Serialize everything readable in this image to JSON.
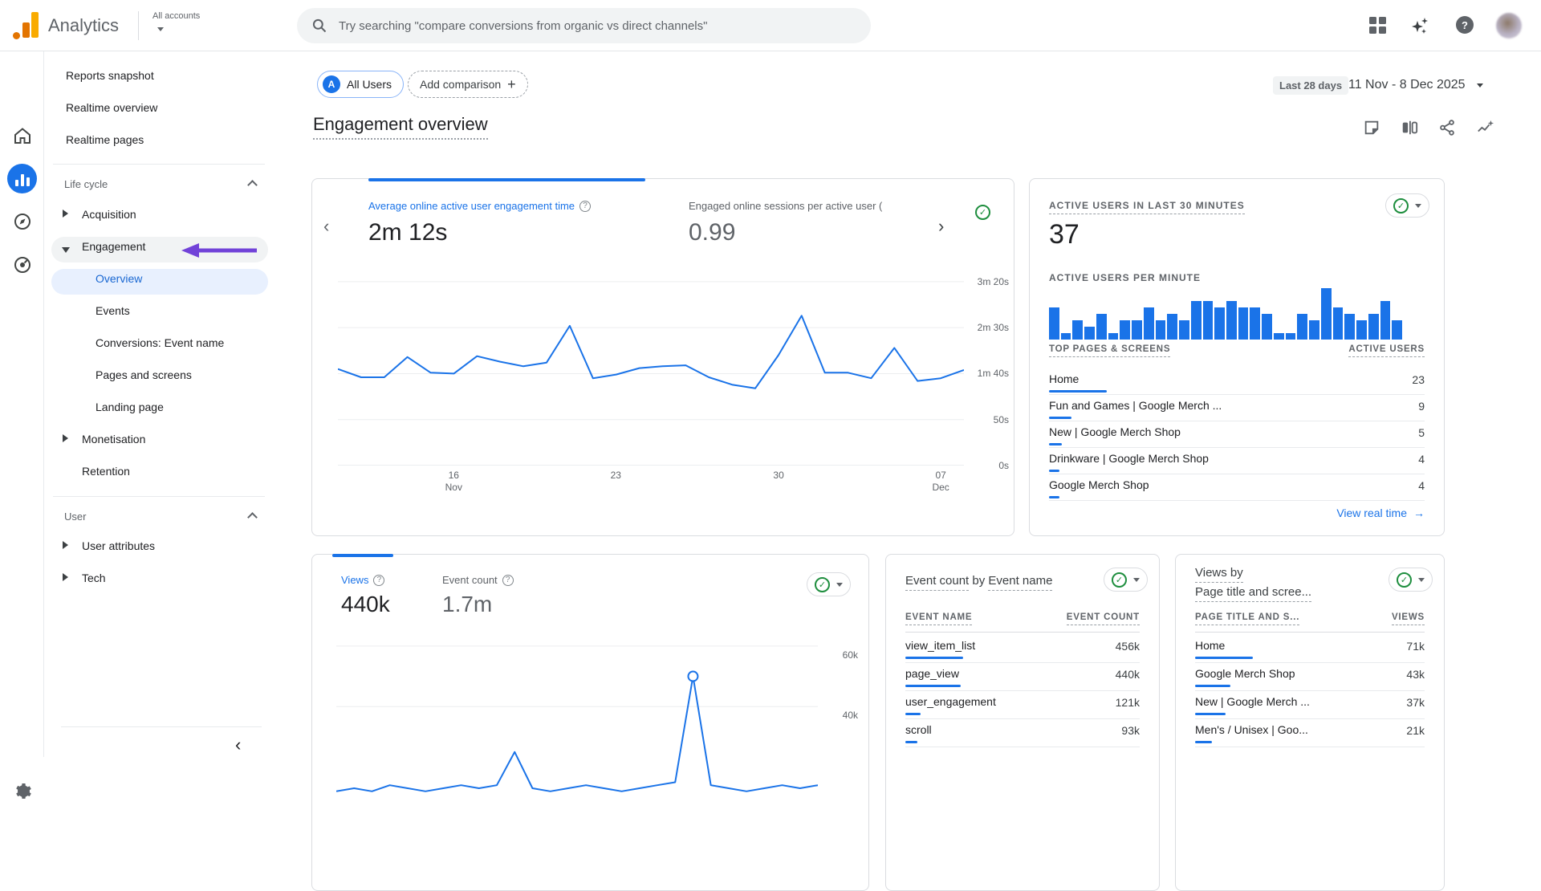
{
  "colors": {
    "accent": "#1a73e8",
    "green_check": "#1e8e3e",
    "annotation_purple": "#7142d8",
    "bar_blue": "#1a73e8"
  },
  "icons": {
    "topbar": [
      "apps-grid-icon",
      "ai-sparkle-icon",
      "help-icon",
      "avatar"
    ],
    "rail": [
      "home-icon",
      "reports-icon",
      "explore-icon",
      "advertising-icon",
      "settings-gear-icon"
    ],
    "report_actions": [
      "note-icon",
      "ab-compare-icon",
      "share-icon",
      "insights-icon"
    ]
  },
  "topbar": {
    "product": "Analytics",
    "account": "All accounts",
    "search_placeholder": "Try searching \"compare conversions from organic vs direct channels\""
  },
  "sidebar": {
    "top_items": [
      "Reports snapshot",
      "Realtime overview",
      "Realtime pages"
    ],
    "lifecycle_header": "Life cycle",
    "acquisition": "Acquisition",
    "engagement": "Engagement",
    "engagement_children": [
      "Overview",
      "Events",
      "Conversions: Event name",
      "Pages and screens",
      "Landing page"
    ],
    "selected_child": "Overview",
    "monetisation": "Monetisation",
    "retention": "Retention",
    "user_header": "User",
    "user_items": [
      "User attributes",
      "Tech"
    ]
  },
  "controls": {
    "all_users_badge": "A",
    "all_users": "All Users",
    "add_comparison": "Add comparison",
    "date_preset": "Last 28 days",
    "date_range": "11 Nov - 8 Dec 2025"
  },
  "page": {
    "title": "Engagement overview"
  },
  "cards": {
    "engagement": {
      "metric1_label": "Average online active user engagement time",
      "metric1_value": "2m 12s",
      "metric2_label": "Engaged online sessions per active user (",
      "metric2_value": "0.99"
    },
    "realtime": {
      "title": "ACTIVE USERS IN LAST 30 MINUTES",
      "value": "37",
      "per_minute_label": "ACTIVE USERS PER MINUTE",
      "col1": "TOP PAGES & SCREENS",
      "col2": "ACTIVE USERS",
      "rows": [
        {
          "label": "Home",
          "value": "23",
          "num": 23
        },
        {
          "label": "Fun and Games | Google Merch ...",
          "value": "9",
          "num": 9
        },
        {
          "label": "New | Google Merch Shop",
          "value": "5",
          "num": 5
        },
        {
          "label": "Drinkware | Google Merch Shop",
          "value": "4",
          "num": 4
        },
        {
          "label": "Google Merch Shop",
          "value": "4",
          "num": 4
        }
      ],
      "link": "View real time"
    },
    "views": {
      "metric1_label": "Views",
      "metric1_value": "440k",
      "metric2_label": "Event count",
      "metric2_value": "1.7m"
    },
    "events": {
      "title_part1": "Event count",
      "title_joiner": "by",
      "title_part2": "Event name",
      "col1": "EVENT NAME",
      "col2": "EVENT COUNT",
      "rows": [
        {
          "label": "view_item_list",
          "value": "456k",
          "num": 456
        },
        {
          "label": "page_view",
          "value": "440k",
          "num": 440
        },
        {
          "label": "user_engagement",
          "value": "121k",
          "num": 121
        },
        {
          "label": "scroll",
          "value": "93k",
          "num": 93
        }
      ]
    },
    "pages": {
      "title_line1": "Views by",
      "title_line2": "Page title and scree...",
      "col1": "PAGE TITLE AND S...",
      "col2": "VIEWS",
      "rows": [
        {
          "label": "Home",
          "value": "71k",
          "num": 71
        },
        {
          "label": "Google Merch Shop",
          "value": "43k",
          "num": 43
        },
        {
          "label": "New | Google Merch ...",
          "value": "37k",
          "num": 37
        },
        {
          "label": "Men's / Unisex | Goo...",
          "value": "21k",
          "num": 21
        }
      ]
    }
  },
  "chart_data": [
    {
      "id": "engagement-time-trend",
      "type": "line",
      "title": "Average online active user engagement time",
      "unit": "seconds",
      "x_start": "11 Nov 2025",
      "x_end": "8 Dec 2025",
      "values": [
        105,
        96,
        96,
        118,
        101,
        100,
        119,
        113,
        108,
        112,
        152,
        95,
        99,
        106,
        108,
        109,
        96,
        88,
        84,
        120,
        163,
        101,
        101,
        95,
        128,
        92,
        95,
        104
      ],
      "ylim": [
        0,
        213
      ],
      "grid": "on",
      "gridlines": [
        {
          "v": 200,
          "label": "3m 20s"
        },
        {
          "v": 150,
          "label": "2m 30s"
        },
        {
          "v": 100,
          "label": "1m 40s"
        },
        {
          "v": 50,
          "label": "50s"
        },
        {
          "v": 0,
          "label": "0s"
        }
      ],
      "xticks": [
        {
          "frac": 0.185,
          "line1": "16",
          "line2": "Nov"
        },
        {
          "frac": 0.444,
          "line1": "23",
          "line2": ""
        },
        {
          "frac": 0.704,
          "line1": "30",
          "line2": ""
        },
        {
          "frac": 0.963,
          "line1": "07",
          "line2": "Dec"
        }
      ]
    },
    {
      "id": "active-users-per-minute",
      "type": "bar",
      "title": "ACTIVE USERS PER MINUTE",
      "values": [
        5,
        1,
        3,
        2,
        4,
        1,
        3,
        3,
        5,
        3,
        4,
        3,
        6,
        6,
        5,
        6,
        5,
        5,
        4,
        1,
        1,
        4,
        3,
        8,
        5,
        4,
        3,
        4,
        6,
        3
      ]
    },
    {
      "id": "views-trend",
      "type": "line",
      "title": "Views",
      "unit": "thousands",
      "x_start": "11 Nov 2025",
      "x_end": "8 Dec 2025",
      "values": [
        12,
        13,
        12,
        14,
        13,
        12,
        13,
        14,
        13,
        14,
        25,
        13,
        12,
        13,
        14,
        13,
        12,
        13,
        14,
        15,
        50,
        14,
        13,
        12,
        13,
        14,
        13,
        14
      ],
      "ylim": [
        0,
        65
      ],
      "grid": "on",
      "gridlines": [
        {
          "v": 60,
          "label": "60k"
        },
        {
          "v": 40,
          "label": "40k"
        }
      ],
      "marker_index": 20
    }
  ]
}
